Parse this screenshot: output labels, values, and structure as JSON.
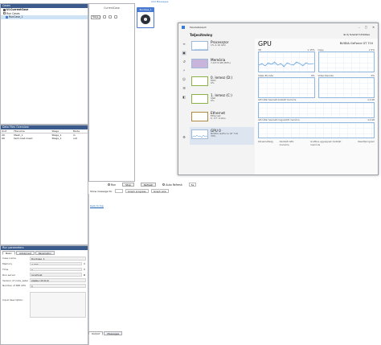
{
  "cases_panel": {
    "title": "Cases",
    "items": [
      {
        "label": "UI.CurrentCase",
        "bold": true
      },
      {
        "label": "Run Cases"
      },
      {
        "label": "RunCase_1",
        "selected": true
      }
    ]
  },
  "canvas": {
    "header": "CurrentCase",
    "stage_label": "Stage_1"
  },
  "ribbon": {
    "title": "Add Messages"
  },
  "run_card": {
    "label": "RunCase_1"
  },
  "files_panel": {
    "title": "Data Files Overview",
    "columns": [
      "Unit",
      "Filename",
      "Stage",
      "Mode"
    ],
    "rows": [
      [
        "20",
        "Mesh_1",
        "Stage_1",
        "in"
      ],
      [
        "99",
        "term-test.mesd",
        "Stage_1",
        "out"
      ]
    ]
  },
  "params_panel": {
    "title": "Run parameters",
    "tabs": [
      "Basic",
      "Advanced",
      "Parametric"
    ],
    "fields": [
      {
        "label": "Case name",
        "value": "RunCase_1"
      },
      {
        "label": "Memory",
        "value": "2,000"
      },
      {
        "label": "Time",
        "value": "0"
      },
      {
        "label": "Run server",
        "value": "localhost"
      },
      {
        "label": "Version of code_aster",
        "value": "stable (15.8.0)"
      },
      {
        "label": "Number of MPI CPU",
        "value": "1"
      }
    ],
    "description_label": "Input description"
  },
  "task_manager": {
    "window_title": "Feladatkezelő",
    "section": "Teljesítmény",
    "new_task": "Új feladat futtatása",
    "items": [
      {
        "name": "Processzor",
        "sub1": "1% 2,16 GHz",
        "sub2": "",
        "kind": "cpu"
      },
      {
        "name": "Memória",
        "sub1": "7,0/7,9 GB (89%)",
        "sub2": "",
        "kind": "mem"
      },
      {
        "name": "0. lemez (D:)",
        "sub1": "HDD",
        "sub2": "0%",
        "kind": "hdd"
      },
      {
        "name": "1. lemez (C:)",
        "sub1": "SSD",
        "sub2": "0%",
        "kind": "hdd"
      },
      {
        "name": "Ethernet",
        "sub1": "Ethernet",
        "sub2": "K: 0 F: 0 kb/s",
        "kind": "eth"
      },
      {
        "name": "GPU 0",
        "sub1": "NVIDIA GeForce GT 710",
        "sub2": "39%",
        "kind": "gpu",
        "selected": true
      }
    ],
    "detail": {
      "heading": "GPU",
      "model": "NVIDIA GeForce GT 710",
      "graphs_row1": [
        {
          "label": "3D",
          "right": "∨ 15%"
        },
        {
          "label": "Copy",
          "right": "∨ 0%"
        }
      ],
      "graphs_row2": [
        {
          "label": "Video Encode",
          "right": "0%"
        },
        {
          "label": "Video Decode",
          "right": "0%"
        }
      ],
      "dedicated_label": "GPU által használt dedikált memória",
      "dedicated_max": "2,0 GB",
      "shared_label": "GPU által használt megosztott memória",
      "shared_max": "4,0 GB",
      "stats": [
        "Kihasználtság",
        "Dedikált GPU-memória",
        "Grafikus egységnek dedikált memória",
        "Illesztőprogram"
      ]
    }
  },
  "run_controls": {
    "run": "Run",
    "stop": "Stop",
    "refresh": "Refresh",
    "auto_refresh": "Auto Refresh",
    "interval": "5s"
  },
  "message_bar": {
    "label": "Show message for",
    "graph_progress": "Graph progress",
    "graph_size": "Graph size"
  },
  "back_to_top": "back to top",
  "output_tabs": [
    "Output",
    "Messages"
  ],
  "colors": {
    "panel_title_bg": "#3a5b8c",
    "accent": "#4a7bd0",
    "graph_line": "#90b8e0"
  }
}
